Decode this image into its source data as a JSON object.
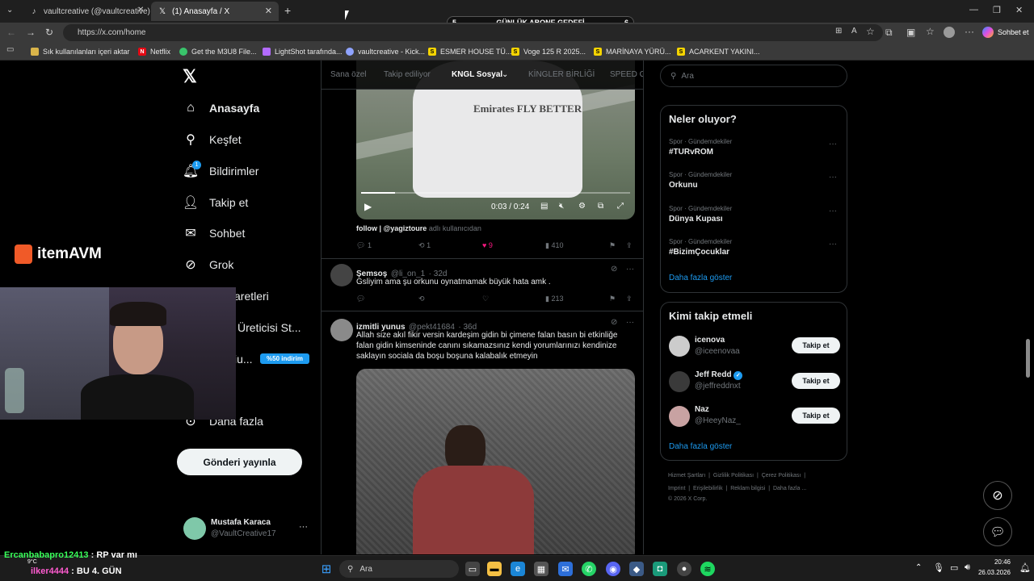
{
  "browser": {
    "tabs": [
      {
        "title": "vaultcreative (@vaultcreative) | Ti",
        "icon": "tiktok-icon",
        "active": false
      },
      {
        "title": "(1) Anasayfa / X",
        "icon": "x-logo-icon",
        "active": true
      }
    ],
    "url": "https://x.com/home",
    "chat_button": "Sohbet et",
    "bookmarks": [
      {
        "label": "Sık kullanılanları içeri aktar",
        "icon": "folder-icon"
      },
      {
        "label": "Netflix",
        "icon": "netflix-icon"
      },
      {
        "label": "Get the M3U8 File...",
        "icon": "extension-icon"
      },
      {
        "label": "LightShot tarafında...",
        "icon": "feather-icon"
      },
      {
        "label": "vaultcreative - Kick...",
        "icon": "kick-icon"
      },
      {
        "label": "ESMER HOUSE TÜ...",
        "icon": "s-icon"
      },
      {
        "label": "Voge 125 R 2025...",
        "icon": "s-icon"
      },
      {
        "label": "MARİNAYA YÜRÜ...",
        "icon": "s-icon"
      },
      {
        "label": "ACARKENT YAKINI...",
        "icon": "s-icon"
      }
    ]
  },
  "overlay": {
    "goal_left": "5",
    "goal_title": "GÜNLÜK ABONE GEDEFİ",
    "goal_right": "6",
    "sponsor_name": "itemAVM",
    "chat_lines": [
      {
        "user": "Ercanbabapro12413",
        "message": ": RP var mı"
      },
      {
        "user": "ilker4444",
        "message": ": BU 4. GÜN"
      }
    ],
    "discount_badge": "%50 indirim"
  },
  "nav": {
    "items": [
      {
        "label": "Anasayfa",
        "icon": "home-icon"
      },
      {
        "label": "Keşfet",
        "icon": "search-icon"
      },
      {
        "label": "Bildirimler",
        "icon": "bell-icon",
        "badge": "1"
      },
      {
        "label": "Takip et",
        "icon": "person-add-icon"
      },
      {
        "label": "Sohbet",
        "icon": "mail-icon"
      },
      {
        "label": "Grok",
        "icon": "grok-icon"
      },
      {
        "label": "aretleri",
        "icon": "bookmark-icon"
      },
      {
        "label": "Üreticisi St...",
        "icon": "lightning-icon"
      },
      {
        "label": "iu...",
        "icon": "premium-icon"
      },
      {
        "label": "Daha fazla",
        "icon": "more-circle-icon"
      }
    ],
    "post_button": "Gönderi yayınla",
    "profile": {
      "name": "Mustafa Karaca",
      "handle": "@VaultCreative17"
    }
  },
  "feed": {
    "tabs": [
      "Sana özel",
      "Takip ediliyor",
      "KNGL Sosyal",
      "KİNGLER BİRLİĞİ",
      "SPEED G"
    ],
    "active_tab": "KNGL Sosyal",
    "video1": {
      "time": "0:03 / 0:24",
      "progress": 0.125,
      "jersey_text": "Emirates FLY BETTER"
    },
    "post1_caption_prefix": "follow | @yagiztoure",
    "post1_caption_suffix": "adlı kullanıcıdan",
    "post1_stats": {
      "replies": "1",
      "reposts": "1",
      "likes": "9",
      "views": "410"
    },
    "post2": {
      "name": "Şemsoş",
      "handle": "@li_on_1",
      "time": "· 32d",
      "text": "Gsliyim ama şu orkunu oynatmamak büyük hata amk .",
      "views": "213"
    },
    "post3": {
      "name": "izmitli yunus",
      "handle": "@pekt41684",
      "time": "· 36d",
      "text": "Allah size akıl fikir versin kardeşim gidin bi çimene falan basın bi etkinliğe falan gidin kimseninde canını sıkamazsınız kendi yorumlarınızı kendinize saklayın sociala da boşu boşuna kalabalık etmeyin"
    }
  },
  "right": {
    "search_placeholder": "Ara",
    "trends_title": "Neler oluyor?",
    "trends": [
      {
        "meta": "Spor · Gündemdekiler",
        "name": "#TURvROM"
      },
      {
        "meta": "Spor · Gündemdekiler",
        "name": "Orkunu"
      },
      {
        "meta": "Spor · Gündemdekiler",
        "name": "Dünya Kupası"
      },
      {
        "meta": "Spor · Gündemdekiler",
        "name": "#BizimÇocuklar"
      }
    ],
    "show_more": "Daha fazla göster",
    "who_title": "Kimi takip etmeli",
    "who": [
      {
        "name": "icenova",
        "handle": "@iceenovaa",
        "verified": false
      },
      {
        "name": "Jeff Redd",
        "handle": "@jeffreddnxt",
        "verified": true
      },
      {
        "name": "Naz",
        "handle": "@HeeyNaz_",
        "verified": false
      }
    ],
    "follow_label": "Takip et",
    "footer_line1": [
      "Hizmet Şartları",
      "Gizlilik Politikası",
      "Çerez Politikası"
    ],
    "footer_line2": [
      "Imprint",
      "Erişilebilirlik",
      "Reklam bilgisi",
      "Daha fazla ..."
    ],
    "copyright": "© 2026 X Corp."
  },
  "taskbar": {
    "search_placeholder": "Ara",
    "weather": "9°C",
    "time": "20:46",
    "date": "26.03.2026"
  },
  "colors": {
    "accent": "#1d9bf0",
    "like": "#f91880",
    "background": "#000000"
  }
}
